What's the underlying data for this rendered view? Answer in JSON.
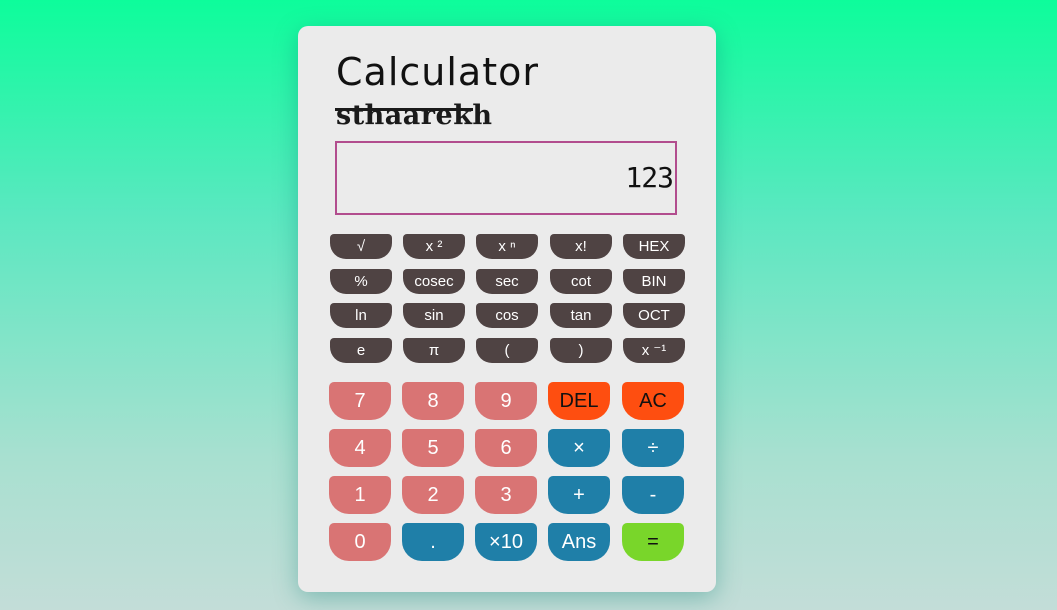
{
  "app": {
    "title": "Calculator",
    "brand": "sthaarekh"
  },
  "display": {
    "value": "123"
  },
  "scientific_keys": [
    [
      "√",
      "x ²",
      "x ⁿ",
      "x!",
      "HEX"
    ],
    [
      "%",
      "cosec",
      "sec",
      "cot",
      "BIN"
    ],
    [
      "ln",
      "sin",
      "cos",
      "tan",
      "OCT"
    ],
    [
      "e",
      "π",
      "(",
      ")",
      "x ⁻¹"
    ]
  ],
  "main_keys": [
    [
      "7",
      "8",
      "9",
      "DEL",
      "AC"
    ],
    [
      "4",
      "5",
      "6",
      "×",
      "÷"
    ],
    [
      "1",
      "2",
      "3",
      "+",
      "-"
    ],
    [
      "0",
      ".",
      "×10",
      "Ans",
      "="
    ]
  ],
  "colors": {
    "number_key": "#d97474",
    "operator_key": "#1f7fa8",
    "delete_key": "#fe4e10",
    "equals_key": "#79d62a",
    "scientific_key": "#4f4343",
    "display_border": "#b24d8e"
  }
}
